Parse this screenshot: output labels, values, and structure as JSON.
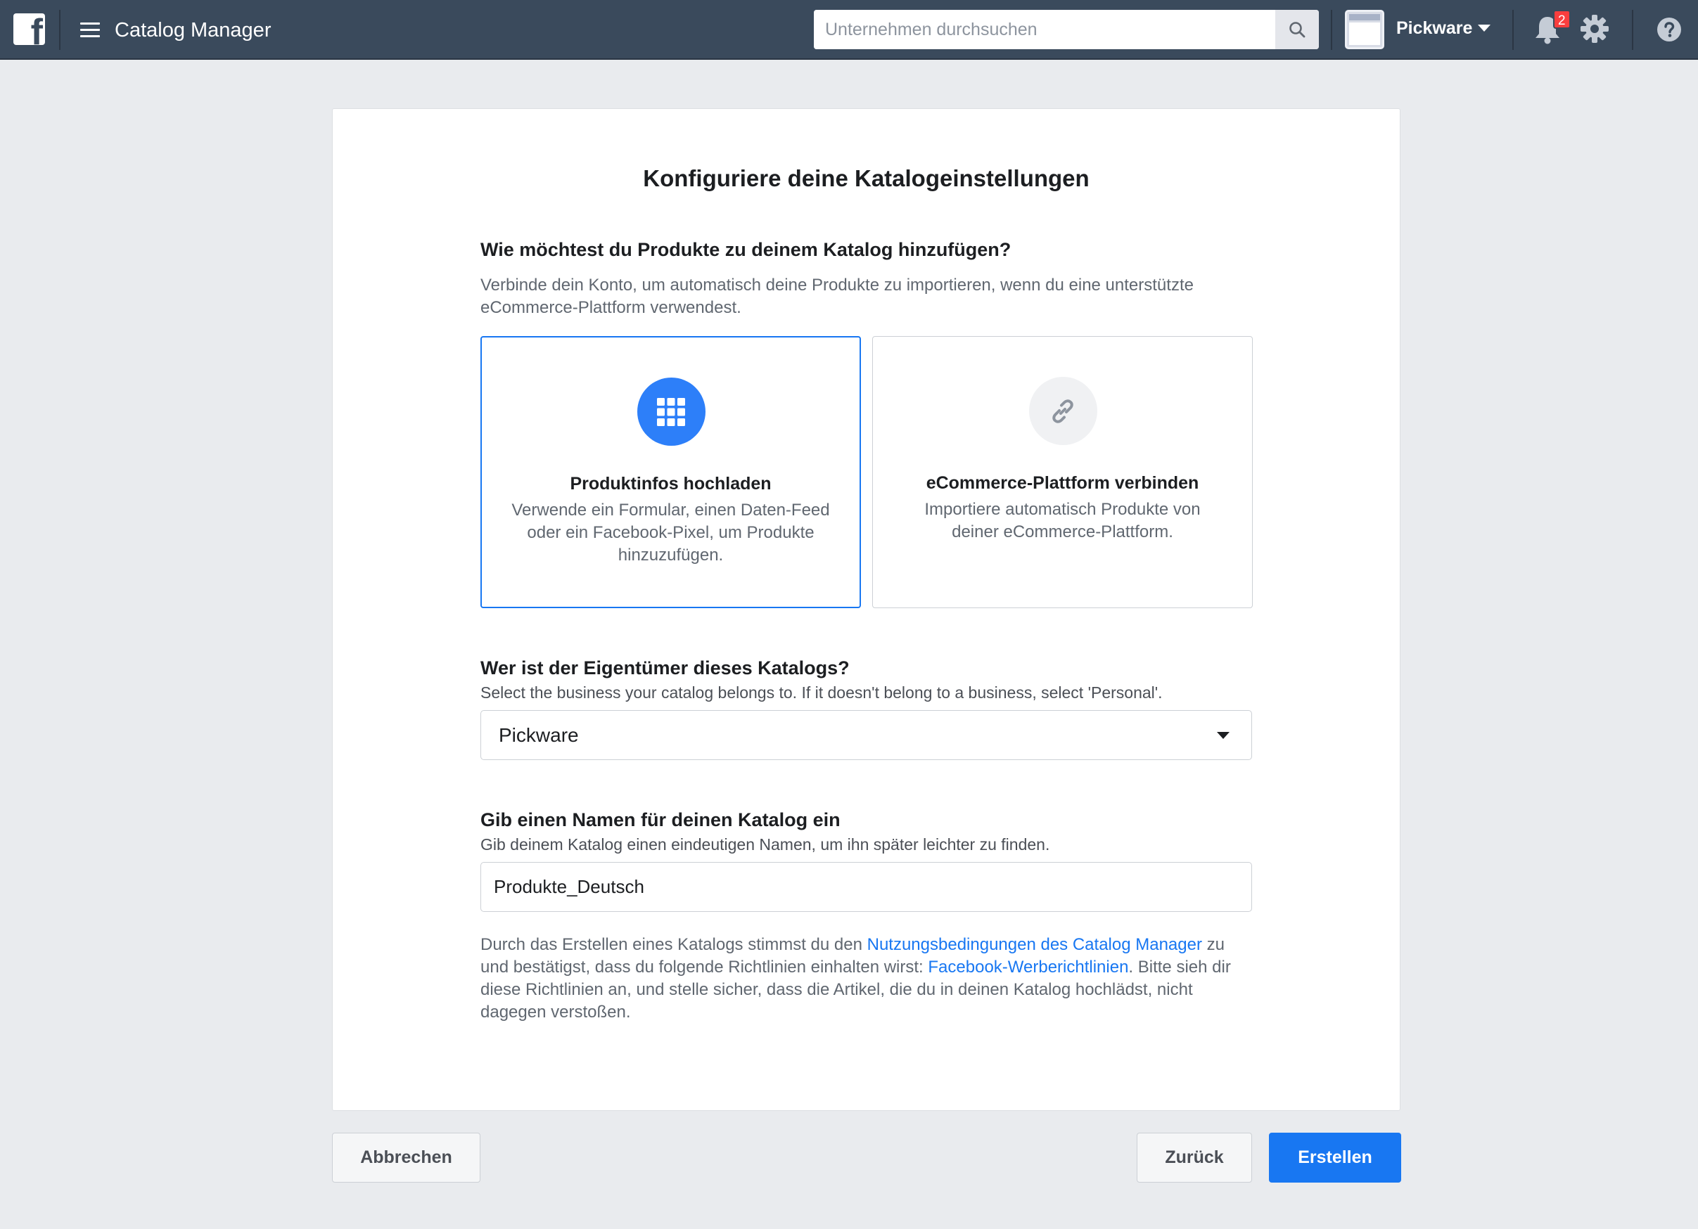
{
  "topbar": {
    "logo_glyph": "f",
    "app_title": "Catalog Manager",
    "search_placeholder": "Unternehmen durchsuchen",
    "business_name": "Pickware",
    "notification_count": "2",
    "icons": [
      "facebook-logo-icon",
      "hamburger-menu-icon",
      "search-icon",
      "business-avatar-icon",
      "caret-down-icon",
      "bell-icon",
      "gear-icon",
      "help-icon"
    ]
  },
  "page": {
    "title": "Konfiguriere deine Katalogeinstellungen",
    "products_section": {
      "heading": "Wie möchtest du Produkte zu deinem Katalog hinzufügen?",
      "description_line1": "Verbinde dein Konto, um automatisch deine Produkte zu importieren, wenn du eine unterstützte",
      "description_line2": "eCommerce-Plattform verwendest.",
      "options": [
        {
          "icon": "grid-icon",
          "title": "Produktinfos hochladen",
          "description": "Verwende ein Formular, einen Daten-Feed oder ein Facebook-Pixel, um Produkte hinzuzufügen.",
          "selected": true
        },
        {
          "icon": "link-icon",
          "title": "eCommerce-Plattform verbinden",
          "description": "Importiere automatisch Produkte von deiner eCommerce-Plattform.",
          "selected": false
        }
      ]
    },
    "owner_section": {
      "heading": "Wer ist der Eigentümer dieses Katalogs?",
      "description": "Select the business your catalog belongs to. If it doesn't belong to a business, select 'Personal'.",
      "selected_value": "Pickware"
    },
    "name_section": {
      "heading": "Gib einen Namen für deinen Katalog ein",
      "description": "Gib deinem Katalog einen eindeutigen Namen, um ihn später leichter zu finden.",
      "value": "Produkte_Deutsch"
    },
    "legal": {
      "text1": "Durch das Erstellen eines Katalogs stimmst du den ",
      "link1": "Nutzungsbedingungen des Catalog Manager",
      "text2": " zu und bestätigst, dass du folgende Richtlinien einhalten wirst: ",
      "link2": "Facebook-Werberichtlinien",
      "text3": ". Bitte sieh dir diese Richtlinien an, und stelle sicher, dass die Artikel, die du in deinen Katalog hochlädst, nicht dagegen verstoßen."
    }
  },
  "footer": {
    "cancel_label": "Abbrechen",
    "back_label": "Zurück",
    "create_label": "Erstellen"
  },
  "colors": {
    "topbar": "#3a4a5c",
    "accent": "#1877f2",
    "background": "#e9ebee",
    "badge": "#fa3e3e"
  }
}
